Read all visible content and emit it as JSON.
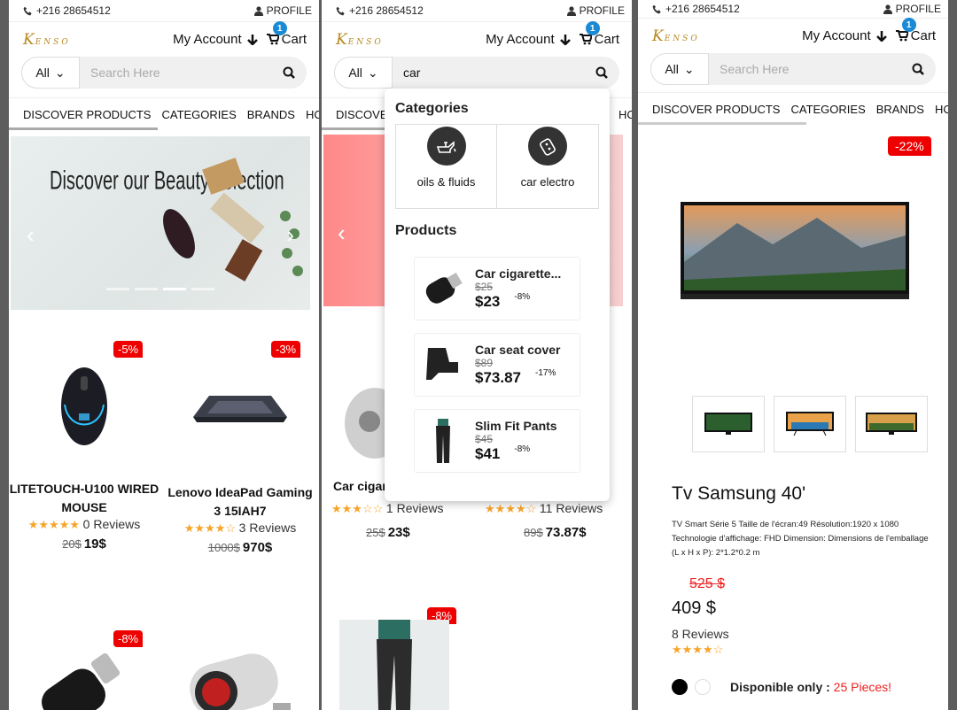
{
  "header": {
    "phone": "+216 28654512",
    "profile": "PROFILE",
    "logo": "Kenso",
    "account": "My Account",
    "cart": "Cart",
    "cart_count": "1"
  },
  "search": {
    "category": "All",
    "placeholder": "Search Here",
    "query": "car"
  },
  "nav": [
    "DISCOVER PRODUCTS",
    "CATEGORIES",
    "BRANDS",
    "HC"
  ],
  "banner": {
    "title": "Discover our Beauty selection"
  },
  "products": [
    {
      "name": "LITETOUCH-U100 WIRED MOUSE",
      "discount": "-5%",
      "stars": "★★★★★",
      "reviews": "0 Reviews",
      "old": "20$",
      "new": "19$"
    },
    {
      "name": "Lenovo IdeaPad Gaming 3 15IAH7",
      "discount": "-3%",
      "stars": "★★★★☆",
      "reviews": "3 Reviews",
      "old": "1000$",
      "new": "970$"
    },
    {
      "discount": "-8%"
    }
  ],
  "panel2": {
    "behind_name": "Car cigar",
    "behind_left": {
      "stars": "★★★☆☆",
      "reviews": "1 Reviews",
      "old": "25$",
      "new": "23$"
    },
    "behind_right": {
      "stars": "★★★★☆",
      "reviews": "11 Reviews",
      "old": "89$",
      "new": "73.87$"
    },
    "behind_discount": "-8%"
  },
  "dropdown": {
    "categories_title": "Categories",
    "categories": [
      {
        "label": "oils & fluids",
        "icon": "oil-can-icon"
      },
      {
        "label": "car electro",
        "icon": "car-key-icon"
      }
    ],
    "products_title": "Products",
    "products": [
      {
        "name": "Car cigarette...",
        "old": "$25",
        "new": "$23",
        "discount": "-8%"
      },
      {
        "name": "Car seat cover",
        "old": "$89",
        "new": "$73.87",
        "discount": "-17%"
      },
      {
        "name": "Slim Fit Pants",
        "old": "$45",
        "new": "$41",
        "discount": "-8%"
      }
    ]
  },
  "detail": {
    "discount": "-22%",
    "title": "Tv Samsung 40'",
    "description": "TV Smart Série 5 Taille de l'écran:49 Résolution:1920 x 1080 Technologie d'affichage: FHD Dimension: Dimensions de l'emballage (L x H x P): 2*1.2*0.2 m",
    "old_price": "525 $",
    "new_price": "409 $",
    "reviews": "8 Reviews",
    "stars": "★★★★☆",
    "availability_label": "Disponible only :",
    "availability_value": "25 Pieces!",
    "colors": [
      "#000000",
      "#ffffff"
    ]
  },
  "colors": {
    "discount_red": "#e00000",
    "badge_blue": "#1a8ad4",
    "star": "#f7a428",
    "logo_gold": "#b78a21"
  }
}
